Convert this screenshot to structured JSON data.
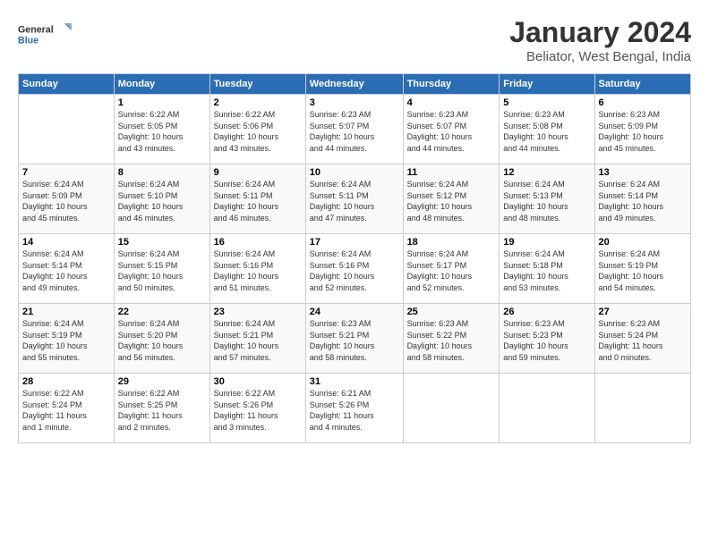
{
  "header": {
    "logo_line1": "General",
    "logo_line2": "Blue",
    "month": "January 2024",
    "location": "Beliator, West Bengal, India"
  },
  "weekdays": [
    "Sunday",
    "Monday",
    "Tuesday",
    "Wednesday",
    "Thursday",
    "Friday",
    "Saturday"
  ],
  "weeks": [
    [
      {
        "day": "",
        "info": ""
      },
      {
        "day": "1",
        "info": "Sunrise: 6:22 AM\nSunset: 5:05 PM\nDaylight: 10 hours\nand 43 minutes."
      },
      {
        "day": "2",
        "info": "Sunrise: 6:22 AM\nSunset: 5:06 PM\nDaylight: 10 hours\nand 43 minutes."
      },
      {
        "day": "3",
        "info": "Sunrise: 6:23 AM\nSunset: 5:07 PM\nDaylight: 10 hours\nand 44 minutes."
      },
      {
        "day": "4",
        "info": "Sunrise: 6:23 AM\nSunset: 5:07 PM\nDaylight: 10 hours\nand 44 minutes."
      },
      {
        "day": "5",
        "info": "Sunrise: 6:23 AM\nSunset: 5:08 PM\nDaylight: 10 hours\nand 44 minutes."
      },
      {
        "day": "6",
        "info": "Sunrise: 6:23 AM\nSunset: 5:09 PM\nDaylight: 10 hours\nand 45 minutes."
      }
    ],
    [
      {
        "day": "7",
        "info": "Sunrise: 6:24 AM\nSunset: 5:09 PM\nDaylight: 10 hours\nand 45 minutes."
      },
      {
        "day": "8",
        "info": "Sunrise: 6:24 AM\nSunset: 5:10 PM\nDaylight: 10 hours\nand 46 minutes."
      },
      {
        "day": "9",
        "info": "Sunrise: 6:24 AM\nSunset: 5:11 PM\nDaylight: 10 hours\nand 46 minutes."
      },
      {
        "day": "10",
        "info": "Sunrise: 6:24 AM\nSunset: 5:11 PM\nDaylight: 10 hours\nand 47 minutes."
      },
      {
        "day": "11",
        "info": "Sunrise: 6:24 AM\nSunset: 5:12 PM\nDaylight: 10 hours\nand 48 minutes."
      },
      {
        "day": "12",
        "info": "Sunrise: 6:24 AM\nSunset: 5:13 PM\nDaylight: 10 hours\nand 48 minutes."
      },
      {
        "day": "13",
        "info": "Sunrise: 6:24 AM\nSunset: 5:14 PM\nDaylight: 10 hours\nand 49 minutes."
      }
    ],
    [
      {
        "day": "14",
        "info": "Sunrise: 6:24 AM\nSunset: 5:14 PM\nDaylight: 10 hours\nand 49 minutes."
      },
      {
        "day": "15",
        "info": "Sunrise: 6:24 AM\nSunset: 5:15 PM\nDaylight: 10 hours\nand 50 minutes."
      },
      {
        "day": "16",
        "info": "Sunrise: 6:24 AM\nSunset: 5:16 PM\nDaylight: 10 hours\nand 51 minutes."
      },
      {
        "day": "17",
        "info": "Sunrise: 6:24 AM\nSunset: 5:16 PM\nDaylight: 10 hours\nand 52 minutes."
      },
      {
        "day": "18",
        "info": "Sunrise: 6:24 AM\nSunset: 5:17 PM\nDaylight: 10 hours\nand 52 minutes."
      },
      {
        "day": "19",
        "info": "Sunrise: 6:24 AM\nSunset: 5:18 PM\nDaylight: 10 hours\nand 53 minutes."
      },
      {
        "day": "20",
        "info": "Sunrise: 6:24 AM\nSunset: 5:19 PM\nDaylight: 10 hours\nand 54 minutes."
      }
    ],
    [
      {
        "day": "21",
        "info": "Sunrise: 6:24 AM\nSunset: 5:19 PM\nDaylight: 10 hours\nand 55 minutes."
      },
      {
        "day": "22",
        "info": "Sunrise: 6:24 AM\nSunset: 5:20 PM\nDaylight: 10 hours\nand 56 minutes."
      },
      {
        "day": "23",
        "info": "Sunrise: 6:24 AM\nSunset: 5:21 PM\nDaylight: 10 hours\nand 57 minutes."
      },
      {
        "day": "24",
        "info": "Sunrise: 6:23 AM\nSunset: 5:21 PM\nDaylight: 10 hours\nand 58 minutes."
      },
      {
        "day": "25",
        "info": "Sunrise: 6:23 AM\nSunset: 5:22 PM\nDaylight: 10 hours\nand 58 minutes."
      },
      {
        "day": "26",
        "info": "Sunrise: 6:23 AM\nSunset: 5:23 PM\nDaylight: 10 hours\nand 59 minutes."
      },
      {
        "day": "27",
        "info": "Sunrise: 6:23 AM\nSunset: 5:24 PM\nDaylight: 11 hours\nand 0 minutes."
      }
    ],
    [
      {
        "day": "28",
        "info": "Sunrise: 6:22 AM\nSunset: 5:24 PM\nDaylight: 11 hours\nand 1 minute."
      },
      {
        "day": "29",
        "info": "Sunrise: 6:22 AM\nSunset: 5:25 PM\nDaylight: 11 hours\nand 2 minutes."
      },
      {
        "day": "30",
        "info": "Sunrise: 6:22 AM\nSunset: 5:26 PM\nDaylight: 11 hours\nand 3 minutes."
      },
      {
        "day": "31",
        "info": "Sunrise: 6:21 AM\nSunset: 5:26 PM\nDaylight: 11 hours\nand 4 minutes."
      },
      {
        "day": "",
        "info": ""
      },
      {
        "day": "",
        "info": ""
      },
      {
        "day": "",
        "info": ""
      }
    ]
  ]
}
